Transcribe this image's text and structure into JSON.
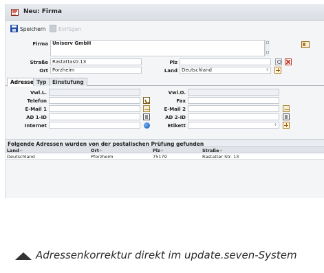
{
  "window": {
    "title": "Neu: Firma"
  },
  "toolbar": {
    "save_label": "Speichern",
    "paste_label": "Einfügen"
  },
  "form": {
    "firma_label": "Firma",
    "firma_value": "Uniserv GmbH",
    "strasse_label": "Straße",
    "strasse_value": "Rastattastr.13",
    "plz_label": "Plz",
    "plz_value": "",
    "ort_label": "Ort",
    "ort_value": "Porzheim",
    "land_label": "Land",
    "land_value": "Deutschland"
  },
  "tabs": [
    {
      "label": "Adresse",
      "active": true
    },
    {
      "label": "Typ",
      "active": false
    },
    {
      "label": "Einstufung",
      "active": false
    }
  ],
  "address": {
    "vwl_l_label": "Vwl.L.",
    "vwl_o_label": "Vwl.O.",
    "telefon_label": "Telefon",
    "fax_label": "Fax",
    "email1_label": "E-Mail 1",
    "email2_label": "E-Mail 2",
    "ad1_label": "AD 1-ID",
    "ad2_label": "AD 2-ID",
    "internet_label": "Internet",
    "etikett_label": "Etikett"
  },
  "results": {
    "title": "Folgende Adressen wurden von der postalischen Prüfung gefunden",
    "columns": [
      "Land",
      "Ort",
      "Plz",
      "Straße"
    ],
    "sort_glyph": "÷",
    "rows": [
      [
        "Deutschland",
        "Pforzheim",
        "75179",
        "Rastatter Str. 13"
      ]
    ]
  },
  "caption": {
    "text": "Adressenkorrektur direkt im update.seven-System"
  },
  "icons": [
    "form-icon",
    "save-icon",
    "paste-icon",
    "search-icon",
    "delete-icon",
    "add-icon",
    "business-card-icon",
    "phone-icon",
    "mail-icon",
    "id-card-icon",
    "globe-icon",
    "triangle-up-icon"
  ],
  "colors": {
    "accent": "#1f4fa8",
    "delete": "#c0392b",
    "panel": "#f4f5f7"
  }
}
